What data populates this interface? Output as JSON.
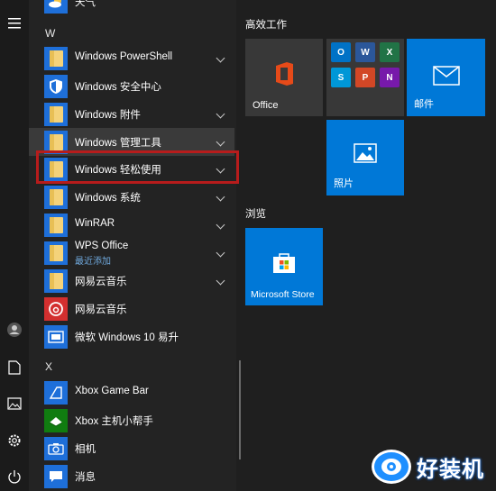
{
  "top_item_label": "天气",
  "section_w": "W",
  "section_x": "X",
  "apps": [
    {
      "label": "Windows PowerShell",
      "icon": "folder-icon",
      "chevron": true
    },
    {
      "label": "Windows 安全中心",
      "icon": "shield-icon",
      "chevron": false
    },
    {
      "label": "Windows 附件",
      "icon": "folder-icon",
      "chevron": true
    },
    {
      "label": "Windows 管理工具",
      "icon": "folder-icon",
      "chevron": true
    },
    {
      "label": "Windows 轻松使用",
      "icon": "folder-icon",
      "chevron": true
    },
    {
      "label": "Windows 系统",
      "icon": "folder-icon",
      "chevron": true
    },
    {
      "label": "WinRAR",
      "icon": "folder-icon",
      "chevron": true
    },
    {
      "label": "WPS Office",
      "sub": "最近添加",
      "icon": "folder-icon",
      "chevron": true
    },
    {
      "label": "网易云音乐",
      "icon": "folder-icon",
      "chevron": true
    },
    {
      "label": "网易云音乐",
      "icon": "netease-music-icon",
      "chevron": false
    },
    {
      "label": "微软 Windows 10 易升",
      "icon": "upgrade-assistant-icon",
      "chevron": false
    },
    {
      "label": "Xbox Game Bar",
      "icon": "xbox-game-bar-icon",
      "chevron": false
    },
    {
      "label": "Xbox 主机小帮手",
      "icon": "xbox-companion-icon",
      "chevron": false
    },
    {
      "label": "相机",
      "icon": "camera-icon",
      "chevron": false
    },
    {
      "label": "消息",
      "icon": "message-icon",
      "chevron": false
    }
  ],
  "groups": {
    "productivity": "高效工作",
    "browse": "浏览"
  },
  "tiles": {
    "office": "Office",
    "mail": "邮件",
    "photos": "照片",
    "store": "Microsoft Store"
  },
  "watermark": "好装机",
  "colors": {
    "tile_blue": "#0078d7",
    "highlight_red": "#b71c1c"
  }
}
